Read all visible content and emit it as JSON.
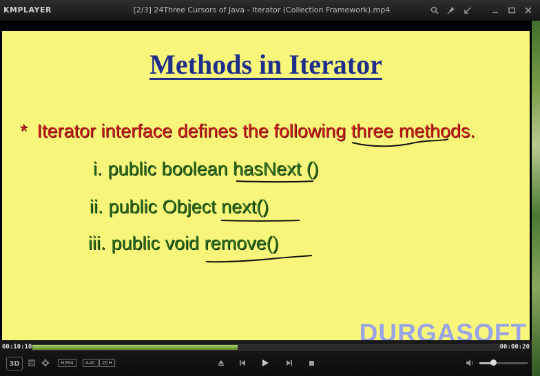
{
  "window": {
    "logo": "KMPLAYER",
    "title": "[2/3] 24Three Cursors of Java - Iterator  (Collection Framework).mp4",
    "icons": [
      "search-icon",
      "pin-icon",
      "minimize-to-mini-icon",
      "minimize-icon",
      "maximize-icon",
      "close-icon"
    ]
  },
  "slide": {
    "title": "Methods in Iterator",
    "bullet_star": "*",
    "bullet_text": "Iterator interface defines the following three methods.",
    "methods": [
      {
        "num": "i.",
        "text": "public boolean hasNext ()"
      },
      {
        "num": "ii.",
        "text": "public Object next()"
      },
      {
        "num": "iii.",
        "text": "public void remove()"
      }
    ],
    "watermark": "DURGASOFT",
    "colors": {
      "background": "#f8f67a",
      "title": "#1f2e8a",
      "bullet": "#c81a1a",
      "methods": "#2a6b1c",
      "watermark": "#9aa3e6"
    }
  },
  "player": {
    "elapsed": "00:10:10",
    "duration": "00:00:20",
    "progress_fraction": 0.44,
    "volume_fraction": 0.28,
    "badges": [
      "H264",
      "AAC",
      "2CH"
    ],
    "three_d_label": "3D"
  }
}
